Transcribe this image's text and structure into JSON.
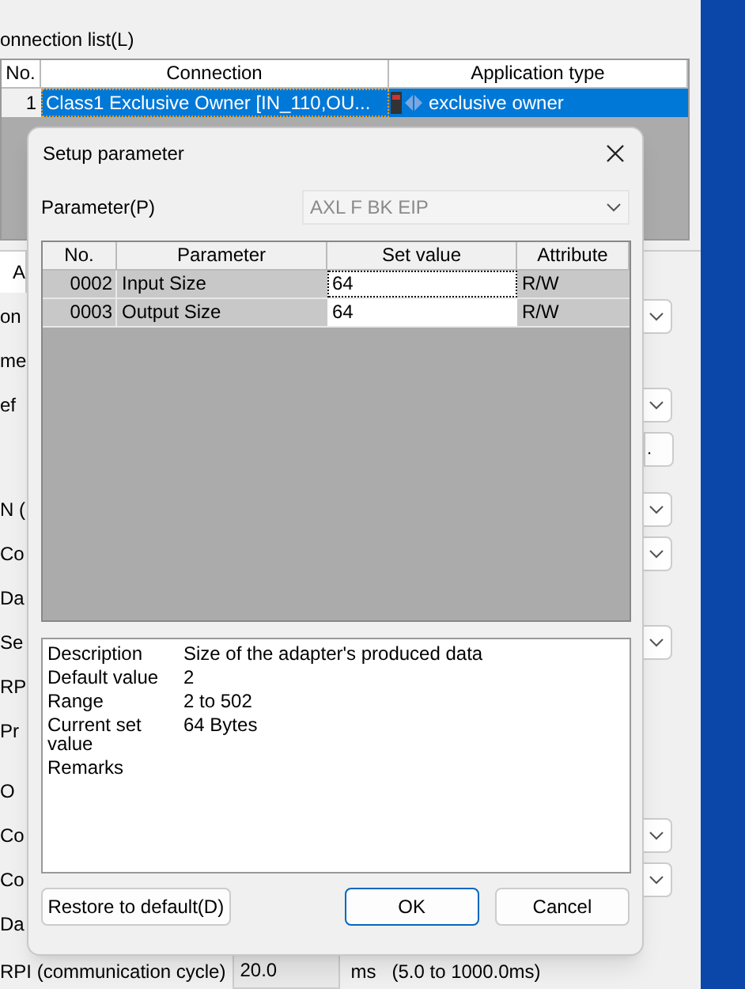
{
  "connection_list": {
    "label": "onnection list(L)",
    "columns": [
      "No.",
      "Connection",
      "Application type"
    ],
    "rows": [
      {
        "no": "1",
        "connection": "Class1 Exclusive Owner [IN_110,OU...",
        "application_type": "exclusive owner",
        "selected": true
      }
    ]
  },
  "tab": {
    "label": "A"
  },
  "form_rows": [
    {
      "label": "on",
      "kind": "dropdown"
    },
    {
      "label": "me",
      "kind": "none"
    },
    {
      "label": "ef",
      "kind": "dropdown"
    },
    {
      "label": "",
      "kind": "button",
      "button": "."
    },
    {
      "label": "N (",
      "kind": "dropdown"
    },
    {
      "label": "Co",
      "kind": "dropdown"
    },
    {
      "label": "Da",
      "kind": "none"
    },
    {
      "label": "Se",
      "kind": "dropdown"
    },
    {
      "label": "RP",
      "kind": "none"
    },
    {
      "label": "Pr",
      "kind": "none"
    },
    {
      "label": "O",
      "kind": "none"
    },
    {
      "label": "Co",
      "kind": "dropdown"
    },
    {
      "label": "Co",
      "kind": "dropdown"
    },
    {
      "label": "Da",
      "kind": "none"
    }
  ],
  "rpi": {
    "label": "RPI (communication cycle)",
    "value": "20.0",
    "unit": "ms",
    "range": "(5.0 to 1000.0ms)"
  },
  "dialog": {
    "title": "Setup parameter",
    "parameter_label": "Parameter(P)",
    "parameter_value": "AXL F BK EIP",
    "parameter_disabled": true,
    "columns": [
      "No.",
      "Parameter",
      "Set value",
      "Attribute"
    ],
    "rows": [
      {
        "no": "0002",
        "parameter": "Input Size",
        "set_value": "64",
        "attribute": "R/W",
        "focused": true
      },
      {
        "no": "0003",
        "parameter": "Output Size",
        "set_value": "64",
        "attribute": "R/W",
        "focused": false
      }
    ],
    "info": [
      {
        "label": "Description",
        "value": "Size of the adapter's produced data"
      },
      {
        "label": "Default value",
        "value": "2"
      },
      {
        "label": "Range",
        "value": "2 to 502"
      },
      {
        "label": "Current set value",
        "value": "64 Bytes"
      },
      {
        "label": "Remarks"
      }
    ],
    "buttons": [
      {
        "label": "Restore to default(D)",
        "default": false
      },
      {
        "label": "OK",
        "default": true
      },
      {
        "label": "Cancel",
        "default": false
      }
    ]
  }
}
